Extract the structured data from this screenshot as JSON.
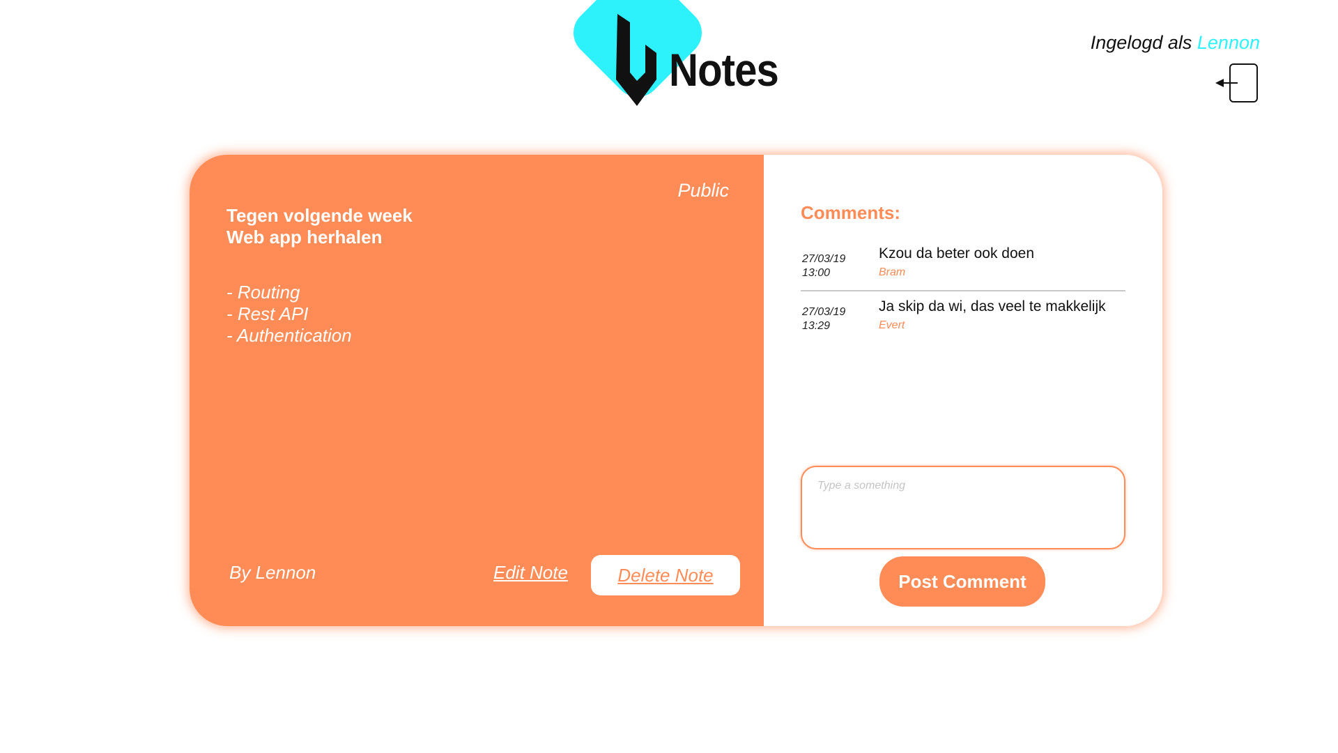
{
  "app": {
    "logo_text": "Notes",
    "logo_icon": "u-shield-icon",
    "brand_color": "#2ef2fb",
    "accent_color": "#ff8b56"
  },
  "user": {
    "logged_in_prefix": "Ingelogd als ",
    "username": "Lennon",
    "logout_icon": "logout-door-icon"
  },
  "note": {
    "visibility": "Public",
    "title_lines": [
      "Tegen volgende week",
      "Web app herhalen"
    ],
    "list_items": [
      "- Routing",
      "- Rest API",
      "- Authentication"
    ],
    "author": "By Lennon",
    "edit_label": "Edit Note",
    "delete_label": "Delete Note"
  },
  "comments": {
    "title": "Comments:",
    "items": [
      {
        "date": "27/03/19",
        "time": "13:00",
        "text": "Kzou da beter ook doen",
        "author": "Bram"
      },
      {
        "date": "27/03/19",
        "time": "13:29",
        "text": "Ja skip da wi, das veel te makkelijk",
        "author": "Evert"
      }
    ],
    "input_placeholder": "Type a something",
    "post_label": "Post Comment"
  }
}
